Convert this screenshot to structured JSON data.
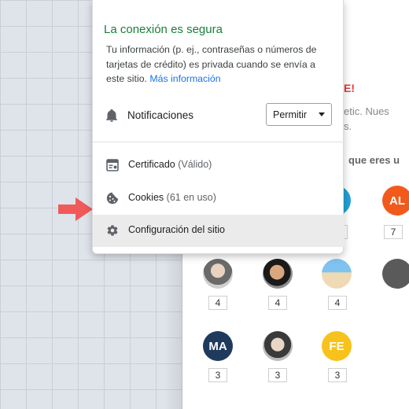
{
  "popup": {
    "title": "La conexión es segura",
    "description_text": "Tu información (p. ej., contraseñas o números de tarjetas de crédito) es privada cuando se envía a este sitio.",
    "more_info_link": "Más información",
    "notifications": {
      "label": "Notificaciones",
      "selected_value": "Permitir"
    },
    "items": [
      {
        "label": "Certificado",
        "sub": "(Válido)",
        "icon": "certificate-icon"
      },
      {
        "label": "Cookies",
        "sub": "(61 en uso)",
        "icon": "cookie-icon"
      },
      {
        "label": "Configuración del sitio",
        "sub": "",
        "icon": "gear-icon"
      }
    ]
  },
  "background_page": {
    "headline_fragment": "E!",
    "text_line_1": "etic. Nues",
    "text_line_2": "s.",
    "section_label": "que eres u",
    "avatars": [
      {
        "initials": "AL",
        "count": "7"
      },
      {
        "initials": "",
        "count": "4"
      },
      {
        "initials": "",
        "count": "4"
      },
      {
        "initials": "",
        "count": "4"
      },
      {
        "initials": "MA",
        "count": "3"
      },
      {
        "initials": "",
        "count": "3"
      },
      {
        "initials": "FE",
        "count": "3"
      }
    ]
  },
  "colors": {
    "secure_green": "#188038",
    "link_blue": "#1a73e8",
    "arrow_red": "#f05a5a",
    "highlight_row": "#ebebeb"
  }
}
